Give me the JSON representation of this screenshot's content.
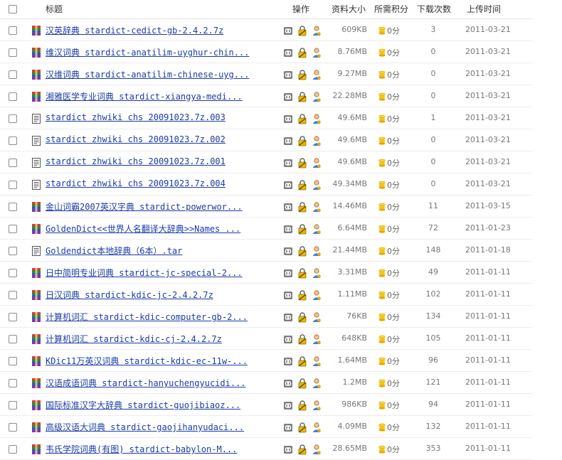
{
  "header": {
    "title": "标题",
    "ops": "操作",
    "size": "资料大小",
    "points": "所需积分",
    "downloads": "下载次数",
    "date": "上传时间"
  },
  "icons": {
    "checkbox": "checkbox-icon",
    "archive": "rar-archive-icon",
    "text_file": "text-file-icon",
    "link": "link-chain-icon",
    "lock": "lock-icon",
    "user": "user-icon",
    "coin": "coin-icon"
  },
  "colors": {
    "link": "#1a3ca8",
    "text_muted": "#777777"
  },
  "rows": [
    {
      "icon": "archive",
      "title": "汉英辞典 stardict-cedict-gb-2.4.2.7z",
      "size": "609KB",
      "points": "0分",
      "downloads": "3",
      "date": "2011-03-21"
    },
    {
      "icon": "archive",
      "title": "维汉词典 stardict-anatilim-uyghur-chin...",
      "size": "8.76MB",
      "points": "0分",
      "downloads": "0",
      "date": "2011-03-21"
    },
    {
      "icon": "archive",
      "title": "汉维词典 stardict-anatilim-chinese-uyg...",
      "size": "9.27MB",
      "points": "0分",
      "downloads": "0",
      "date": "2011-03-21"
    },
    {
      "icon": "archive",
      "title": "湘雅医学专业词典 stardict-xiangya-medi...",
      "size": "22.28MB",
      "points": "0分",
      "downloads": "0",
      "date": "2011-03-21"
    },
    {
      "icon": "text",
      "title": "stardict zhwiki chs 20091023.7z.003",
      "size": "49.6MB",
      "points": "0分",
      "downloads": "1",
      "date": "2011-03-21"
    },
    {
      "icon": "text",
      "title": "stardict zhwiki chs 20091023.7z.002",
      "size": "49.6MB",
      "points": "0分",
      "downloads": "0",
      "date": "2011-03-21"
    },
    {
      "icon": "text",
      "title": "stardict zhwiki chs 20091023.7z.001",
      "size": "49.6MB",
      "points": "0分",
      "downloads": "0",
      "date": "2011-03-21"
    },
    {
      "icon": "text",
      "title": "stardict zhwiki chs 20091023.7z.004",
      "size": "49.34MB",
      "points": "0分",
      "downloads": "0",
      "date": "2011-03-21"
    },
    {
      "icon": "archive",
      "title": "金山词霸2007英汉字典 stardict-powerwor...",
      "size": "14.46MB",
      "points": "0分",
      "downloads": "11",
      "date": "2011-03-15"
    },
    {
      "icon": "archive",
      "title": "GoldenDict<<世界人名翻译大辞典>>Names ...",
      "size": "6.64MB",
      "points": "0分",
      "downloads": "72",
      "date": "2011-01-23"
    },
    {
      "icon": "text",
      "title": "Goldendict本地辞典（6本）.tar",
      "size": "21.44MB",
      "points": "0分",
      "downloads": "148",
      "date": "2011-01-18"
    },
    {
      "icon": "archive",
      "title": "日中简明专业词典 stardict-jc-special-2...",
      "size": "3.31MB",
      "points": "0分",
      "downloads": "49",
      "date": "2011-01-11"
    },
    {
      "icon": "archive",
      "title": "日汉词典 stardict-kdic-jc-2.4.2.7z",
      "size": "1.11MB",
      "points": "0分",
      "downloads": "102",
      "date": "2011-01-11"
    },
    {
      "icon": "archive",
      "title": "计算机词汇 stardict-kdic-computer-gb-2...",
      "size": "76KB",
      "points": "0分",
      "downloads": "134",
      "date": "2011-01-11"
    },
    {
      "icon": "archive",
      "title": "计算机词汇 stardict-kdic-cj-2.4.2.7z",
      "size": "648KB",
      "points": "0分",
      "downloads": "105",
      "date": "2011-01-11"
    },
    {
      "icon": "archive",
      "title": "KDic11万英汉词典 stardict-kdic-ec-11w-...",
      "size": "1.64MB",
      "points": "0分",
      "downloads": "96",
      "date": "2011-01-11"
    },
    {
      "icon": "archive",
      "title": "汉语成语词典 stardict-hanyuchengyucidi...",
      "size": "1.2MB",
      "points": "0分",
      "downloads": "121",
      "date": "2011-01-11"
    },
    {
      "icon": "archive",
      "title": "国际标准汉字大辞典 stardict-guojibiaoz...",
      "size": "986KB",
      "points": "0分",
      "downloads": "94",
      "date": "2011-01-11"
    },
    {
      "icon": "archive",
      "title": "高级汉语大词典 stardict-gaojihanyudaci...",
      "size": "4.09MB",
      "points": "0分",
      "downloads": "132",
      "date": "2011-01-11"
    },
    {
      "icon": "archive",
      "title": "韦氏学院词典(有图)  stardict-babylon-M...",
      "size": "28.65MB",
      "points": "0分",
      "downloads": "353",
      "date": "2011-01-11"
    }
  ]
}
